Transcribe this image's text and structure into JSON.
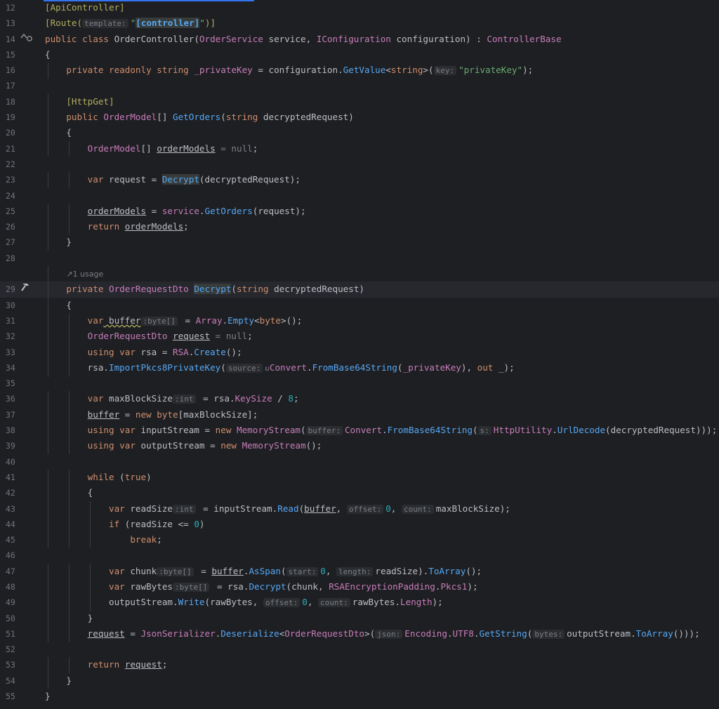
{
  "editor": {
    "lines": [
      {
        "n": "12"
      },
      {
        "n": "13"
      },
      {
        "n": "14"
      },
      {
        "n": "15"
      },
      {
        "n": "16"
      },
      {
        "n": "17"
      },
      {
        "n": "18"
      },
      {
        "n": "19"
      },
      {
        "n": "20"
      },
      {
        "n": "21"
      },
      {
        "n": "22"
      },
      {
        "n": "23"
      },
      {
        "n": "24"
      },
      {
        "n": "25"
      },
      {
        "n": "26"
      },
      {
        "n": "27"
      },
      {
        "n": "28"
      },
      {
        "n": ""
      },
      {
        "n": "29"
      },
      {
        "n": "30"
      },
      {
        "n": "31"
      },
      {
        "n": "32"
      },
      {
        "n": "33"
      },
      {
        "n": "34"
      },
      {
        "n": "35"
      },
      {
        "n": "36"
      },
      {
        "n": "37"
      },
      {
        "n": "38"
      },
      {
        "n": "39"
      },
      {
        "n": "40"
      },
      {
        "n": "41"
      },
      {
        "n": "42"
      },
      {
        "n": "43"
      },
      {
        "n": "44"
      },
      {
        "n": "45"
      },
      {
        "n": "46"
      },
      {
        "n": "47"
      },
      {
        "n": "48"
      },
      {
        "n": "49"
      },
      {
        "n": "50"
      },
      {
        "n": "51"
      },
      {
        "n": "52"
      },
      {
        "n": "53"
      },
      {
        "n": "54"
      },
      {
        "n": "55"
      }
    ],
    "usage_hint": "1 usage",
    "gutter_icons": {
      "line14": "implemented-override-icon",
      "line29": "hammer-icon"
    },
    "colors": {
      "background": "#1e1f22",
      "keyword": "#cf8e6d",
      "string": "#6aab73",
      "number": "#2aacb8",
      "method": "#56a8f5",
      "type": "#c77dbb"
    }
  },
  "code": {
    "l12": "[ApiController]",
    "l13_a": "[Route(",
    "l13_hint": "template:",
    "l13_s1": "\"",
    "l13_b": "[controller]",
    "l13_s2": "\"",
    "l13_c": ")]",
    "l14_a": "public class ",
    "l14_b": "OrderController",
    "l14_c": "(",
    "l14_d": "OrderService",
    "l14_e": " service, ",
    "l14_f": "IConfiguration",
    "l14_g": " configuration) : ",
    "l14_h": "ControllerBase",
    "l15": "{",
    "l16_a": "private readonly ",
    "l16_b": "string",
    "l16_c": " _privateKey",
    "l16_d": " = configuration.",
    "l16_e": "GetValue",
    "l16_f": "<",
    "l16_g": "string",
    "l16_h": ">(",
    "l16_hint": "key:",
    "l16_i": "\"privateKey\"",
    "l16_j": ");",
    "l18": "[HttpGet]",
    "l19_a": "public ",
    "l19_b": "OrderModel",
    "l19_c": "[] ",
    "l19_d": "GetOrders",
    "l19_e": "(",
    "l19_f": "string",
    "l19_g": " decryptedRequest)",
    "l20": "{",
    "l21_a": "OrderModel",
    "l21_b": "[] ",
    "l21_c": "orderModels",
    "l21_d": " = ",
    "l21_e": "null",
    "l21_f": ";",
    "l23_a": "var",
    "l23_b": " request = ",
    "l23_c": "Decrypt",
    "l23_d": "(decryptedRequest);",
    "l25_a": "orderModels",
    "l25_b": " = ",
    "l25_c": "service",
    "l25_d": ".",
    "l25_e": "GetOrders",
    "l25_f": "(request);",
    "l26_a": "return ",
    "l26_b": "orderModels",
    "l26_c": ";",
    "l27": "}",
    "l29_a": "private ",
    "l29_b": "OrderRequestDto",
    "l29_c": " ",
    "l29_d": "Decrypt",
    "l29_e": "(",
    "l29_f": "string",
    "l29_g": " decryptedRequest)",
    "l30": "{",
    "l31_a": "var",
    "l31_b": " buffer",
    "l31_hint": ":byte[]",
    "l31_c": " = ",
    "l31_d": "Array",
    "l31_e": ".",
    "l31_f": "Empty",
    "l31_g": "<",
    "l31_h": "byte",
    "l31_i": ">();",
    "l32_a": "OrderRequestDto",
    "l32_b": " ",
    "l32_c": "request",
    "l32_d": " = ",
    "l32_e": "null",
    "l32_f": ";",
    "l33_a": "using var",
    "l33_b": " rsa = ",
    "l33_c": "RSA",
    "l33_d": ".",
    "l33_e": "Create",
    "l33_f": "();",
    "l34_a": "rsa.",
    "l34_b": "ImportPkcs8PrivateKey",
    "l34_c": "(",
    "l34_hint": "source:",
    "l34_d": "Convert",
    "l34_e": ".",
    "l34_f": "FromBase64String",
    "l34_g": "(",
    "l34_h": "_privateKey",
    "l34_i": "), ",
    "l34_j": "out",
    "l34_k": " _);",
    "l36_a": "var",
    "l36_b": " maxBlockSize",
    "l36_hint": ":int",
    "l36_c": " = rsa.",
    "l36_d": "KeySize",
    "l36_e": " / ",
    "l36_f": "8",
    "l36_g": ";",
    "l37_a": "buffer",
    "l37_b": " = ",
    "l37_c": "new ",
    "l37_d": "byte",
    "l37_e": "[maxBlockSize];",
    "l38_a": "using var",
    "l38_b": " inputStream = ",
    "l38_c": "new ",
    "l38_d": "MemoryStream",
    "l38_e": "(",
    "l38_hint1": "buffer:",
    "l38_f": "Convert",
    "l38_g": ".",
    "l38_h": "FromBase64String",
    "l38_i": "(",
    "l38_hint2": "s:",
    "l38_j": "HttpUtility",
    "l38_k": ".",
    "l38_l": "UrlDecode",
    "l38_m": "(decryptedRequest)));",
    "l39_a": "using var",
    "l39_b": " outputStream = ",
    "l39_c": "new ",
    "l39_d": "MemoryStream",
    "l39_e": "();",
    "l41_a": "while",
    "l41_b": " (",
    "l41_c": "true",
    "l41_d": ")",
    "l42": "{",
    "l43_a": "var",
    "l43_b": " readSize",
    "l43_hint": ":int",
    "l43_c": " = inputStream.",
    "l43_d": "Read",
    "l43_e": "(",
    "l43_f": "buffer",
    "l43_g": ", ",
    "l43_hint2": "offset:",
    "l43_h": "0",
    "l43_i": ", ",
    "l43_hint3": "count:",
    "l43_j": "maxBlockSize);",
    "l44_a": "if",
    "l44_b": " (readSize <= ",
    "l44_c": "0",
    "l44_d": ")",
    "l45": "break",
    "l45_b": ";",
    "l47_a": "var",
    "l47_b": " chunk",
    "l47_hint": ":byte[]",
    "l47_c": " = ",
    "l47_d": "buffer",
    "l47_e": ".",
    "l47_f": "AsSpan",
    "l47_g": "(",
    "l47_hint2": "start:",
    "l47_h": "0",
    "l47_i": ", ",
    "l47_hint3": "length:",
    "l47_j": "readSize).",
    "l47_k": "ToArray",
    "l47_l": "();",
    "l48_a": "var",
    "l48_b": " rawBytes",
    "l48_hint": ":byte[]",
    "l48_c": " = rsa.",
    "l48_d": "Decrypt",
    "l48_e": "(chunk, ",
    "l48_f": "RSAEncryptionPadding",
    "l48_g": ".",
    "l48_h": "Pkcs1",
    "l48_i": ");",
    "l49_a": "outputStream.",
    "l49_b": "Write",
    "l49_c": "(rawBytes, ",
    "l49_hint": "offset:",
    "l49_d": "0",
    "l49_e": ", ",
    "l49_hint2": "count:",
    "l49_f": "rawBytes.",
    "l49_g": "Length",
    "l49_h": ");",
    "l50": "}",
    "l51_a": "request",
    "l51_b": " = ",
    "l51_c": "JsonSerializer",
    "l51_d": ".",
    "l51_e": "Deserialize",
    "l51_f": "<",
    "l51_g": "OrderRequestDto",
    "l51_h": ">(",
    "l51_hint": "json:",
    "l51_i": "Encoding",
    "l51_j": ".",
    "l51_k": "UTF8",
    "l51_l": ".",
    "l51_m": "GetString",
    "l51_n": "(",
    "l51_hint2": "bytes:",
    "l51_o": "outputStream.",
    "l51_p": "ToArray",
    "l51_q": "()));",
    "l53_a": "return ",
    "l53_b": "request",
    "l53_c": ";",
    "l54": "}",
    "l55": "}"
  }
}
